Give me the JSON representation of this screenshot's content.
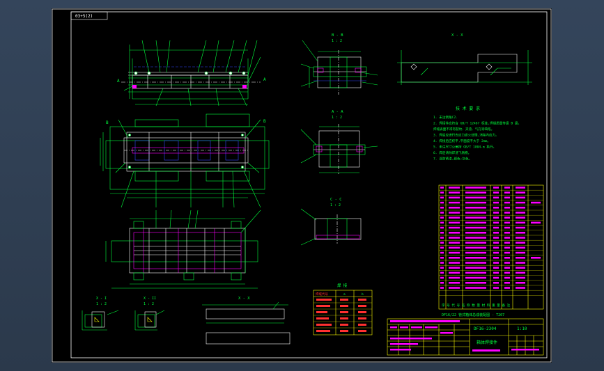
{
  "sheet": {
    "stamp": "03+5(2)",
    "background": "#000000",
    "frame_color": "#ffffff",
    "colors": {
      "green": "#00ff3c",
      "white": "#ffffff",
      "yellow": "#ffff00",
      "magenta": "#ff00ff",
      "blue": "#3344ff",
      "cyan": "#00ffff",
      "red": "#ff3030"
    }
  },
  "views": {
    "front_left_label": "A",
    "front_right_label": "A",
    "top_left_label": "B",
    "top_right_label": "B",
    "section_bb": "B - B",
    "section_bb_scale": "1 : 2",
    "section_aa": "A - A",
    "section_aa_scale": "1 : 2",
    "section_cc": "C - C",
    "section_cc_scale": "1 : 2",
    "detail_right": "X - X",
    "detail_small_left": "X - I",
    "detail_small_left_scale": "1 : 2",
    "detail_small_right": "X - II",
    "detail_small_right_scale": "1 : 2",
    "detail_bottom": "X - X"
  },
  "notes": {
    "title": "技 术 要 求",
    "lines": [
      "1. 未注倒角C2.",
      "2. 焊接件应符合 GB/T 12467 标准,焊缝质量等级 B 级。",
      "   焊缝表面不得有裂纹、夹渣、气孔等缺陷。",
      "3. 焊后应进行去应力退火处理,消除内应力。",
      "4. 焊接后应校平,平面度不大于 2mm。",
      "5. 未注尺寸公差按 GB/T 1804-m 执行。",
      "6. 焊后清除焊渣飞溅物。",
      "7. 涂防锈漆,颜色:灰色。"
    ]
  },
  "weld_table": {
    "title": "焊 接",
    "headers": [
      "焊缝代号",
      "a",
      "b"
    ]
  },
  "parts_list": {
    "footer_row": "序 号   代 号   名 称   数 量   材 料   重 量   备 注",
    "subtitle": "DF16/22  管式箱体总成装配图 - T207"
  },
  "title_block": {
    "drawing_no": "DF16-2304",
    "scale": "1:10",
    "name": "箱体焊接件"
  }
}
